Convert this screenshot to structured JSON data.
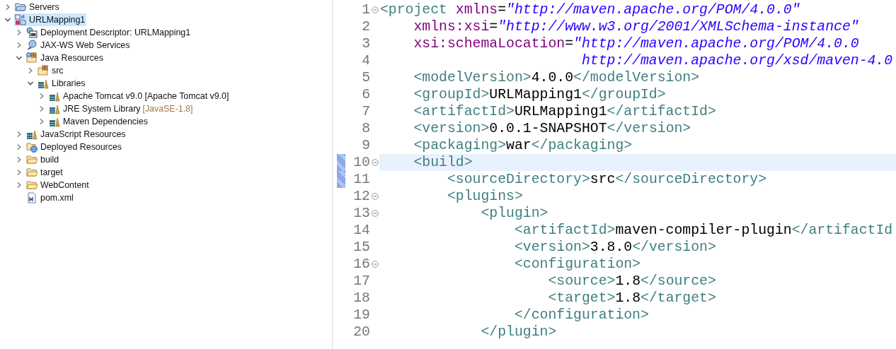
{
  "project_explorer": {
    "items": [
      {
        "label": "Servers",
        "kind": "folder-blue",
        "expanded": false,
        "selected": false
      },
      {
        "label": "URLMapping1",
        "kind": "project",
        "expanded": true,
        "selected": true,
        "children": [
          {
            "label": "Deployment Descriptor: URLMapping1",
            "kind": "descriptor",
            "expanded": false,
            "selected": false
          },
          {
            "label": "JAX-WS Web Services",
            "kind": "webservices",
            "expanded": false,
            "selected": false
          },
          {
            "label": "Java Resources",
            "kind": "java-resources",
            "expanded": true,
            "selected": false,
            "children": [
              {
                "label": "src",
                "kind": "package-folder",
                "expanded": false,
                "selected": false
              },
              {
                "label": "Libraries",
                "kind": "library",
                "expanded": true,
                "selected": false,
                "children": [
                  {
                    "label": "Apache Tomcat v9.0 [Apache Tomcat v9.0]",
                    "kind": "library",
                    "expanded": false,
                    "selected": false
                  },
                  {
                    "label": "JRE System Library",
                    "decoration": "[JavaSE-1.8]",
                    "kind": "library",
                    "expanded": false,
                    "selected": false
                  },
                  {
                    "label": "Maven Dependencies",
                    "kind": "library",
                    "expanded": false,
                    "selected": false
                  }
                ]
              }
            ]
          },
          {
            "label": "JavaScript Resources",
            "kind": "library",
            "expanded": false,
            "selected": false
          },
          {
            "label": "Deployed Resources",
            "kind": "deployed",
            "expanded": false,
            "selected": false
          },
          {
            "label": "build",
            "kind": "folder",
            "expanded": false,
            "selected": false
          },
          {
            "label": "target",
            "kind": "folder",
            "expanded": false,
            "selected": false
          },
          {
            "label": "WebContent",
            "kind": "folder",
            "expanded": false,
            "selected": false
          },
          {
            "label": "pom.xml",
            "kind": "xml-file",
            "selected": false
          }
        ]
      }
    ]
  },
  "editor": {
    "lines": [
      {
        "number": "1",
        "foldable": true,
        "current": false,
        "marked": false,
        "tokens": [
          {
            "kind": "tag",
            "text": "<project "
          },
          {
            "kind": "attr",
            "text": "xmlns"
          },
          {
            "kind": "punct",
            "text": "="
          },
          {
            "kind": "value",
            "text": "\"http://maven.apache.org/POM/4.0.0\""
          }
        ]
      },
      {
        "number": "2",
        "foldable": false,
        "current": false,
        "marked": false,
        "tokens": [
          {
            "kind": "attr",
            "text": "    xmlns:xsi"
          },
          {
            "kind": "punct",
            "text": "="
          },
          {
            "kind": "value",
            "text": "\"http://www.w3.org/2001/XMLSchema-instance\""
          }
        ]
      },
      {
        "number": "3",
        "foldable": false,
        "current": false,
        "marked": false,
        "tokens": [
          {
            "kind": "attr",
            "text": "    xsi:schemaLocation"
          },
          {
            "kind": "punct",
            "text": "="
          },
          {
            "kind": "value",
            "text": "\"http://maven.apache.org/POM/4.0.0"
          }
        ]
      },
      {
        "number": "4",
        "foldable": false,
        "current": false,
        "marked": false,
        "tokens": [
          {
            "kind": "value",
            "text": "                        http://maven.apache.org/xsd/maven-4.0"
          }
        ]
      },
      {
        "number": "5",
        "foldable": false,
        "current": false,
        "marked": false,
        "tokens": [
          {
            "kind": "tag",
            "text": "    <modelVersion>"
          },
          {
            "kind": "text",
            "text": "4.0.0"
          },
          {
            "kind": "tag",
            "text": "</modelVersion>"
          }
        ]
      },
      {
        "number": "6",
        "foldable": false,
        "current": false,
        "marked": false,
        "tokens": [
          {
            "kind": "tag",
            "text": "    <groupId>"
          },
          {
            "kind": "text",
            "text": "URLMapping1"
          },
          {
            "kind": "tag",
            "text": "</groupId>"
          }
        ]
      },
      {
        "number": "7",
        "foldable": false,
        "current": false,
        "marked": false,
        "tokens": [
          {
            "kind": "tag",
            "text": "    <artifactId>"
          },
          {
            "kind": "text",
            "text": "URLMapping1"
          },
          {
            "kind": "tag",
            "text": "</artifactId>"
          }
        ]
      },
      {
        "number": "8",
        "foldable": false,
        "current": false,
        "marked": false,
        "tokens": [
          {
            "kind": "tag",
            "text": "    <version>"
          },
          {
            "kind": "text",
            "text": "0.0.1-SNAPSHOT"
          },
          {
            "kind": "tag",
            "text": "</version>"
          }
        ]
      },
      {
        "number": "9",
        "foldable": false,
        "current": false,
        "marked": false,
        "tokens": [
          {
            "kind": "tag",
            "text": "    <packaging>"
          },
          {
            "kind": "text",
            "text": "war"
          },
          {
            "kind": "tag",
            "text": "</packaging>"
          }
        ]
      },
      {
        "number": "10",
        "foldable": true,
        "current": true,
        "marked": true,
        "tokens": [
          {
            "kind": "tag",
            "text": "    <build>"
          }
        ]
      },
      {
        "number": "11",
        "foldable": false,
        "current": false,
        "marked": true,
        "tokens": [
          {
            "kind": "tag",
            "text": "        <sourceDirectory>"
          },
          {
            "kind": "text",
            "text": "src"
          },
          {
            "kind": "tag",
            "text": "</sourceDirectory>"
          }
        ]
      },
      {
        "number": "12",
        "foldable": true,
        "current": false,
        "marked": false,
        "tokens": [
          {
            "kind": "tag",
            "text": "        <plugins>"
          }
        ]
      },
      {
        "number": "13",
        "foldable": true,
        "current": false,
        "marked": false,
        "tokens": [
          {
            "kind": "tag",
            "text": "            <plugin>"
          }
        ]
      },
      {
        "number": "14",
        "foldable": false,
        "current": false,
        "marked": false,
        "tokens": [
          {
            "kind": "tag",
            "text": "                <artifactId>"
          },
          {
            "kind": "text",
            "text": "maven-compiler-plugin"
          },
          {
            "kind": "tag",
            "text": "</artifactId"
          }
        ]
      },
      {
        "number": "15",
        "foldable": false,
        "current": false,
        "marked": false,
        "tokens": [
          {
            "kind": "tag",
            "text": "                <version>"
          },
          {
            "kind": "text",
            "text": "3.8.0"
          },
          {
            "kind": "tag",
            "text": "</version>"
          }
        ]
      },
      {
        "number": "16",
        "foldable": true,
        "current": false,
        "marked": false,
        "tokens": [
          {
            "kind": "tag",
            "text": "                <configuration>"
          }
        ]
      },
      {
        "number": "17",
        "foldable": false,
        "current": false,
        "marked": false,
        "tokens": [
          {
            "kind": "tag",
            "text": "                    <source>"
          },
          {
            "kind": "text",
            "text": "1.8"
          },
          {
            "kind": "tag",
            "text": "</source>"
          }
        ]
      },
      {
        "number": "18",
        "foldable": false,
        "current": false,
        "marked": false,
        "tokens": [
          {
            "kind": "tag",
            "text": "                    <target>"
          },
          {
            "kind": "text",
            "text": "1.8"
          },
          {
            "kind": "tag",
            "text": "</target>"
          }
        ]
      },
      {
        "number": "19",
        "foldable": false,
        "current": false,
        "marked": false,
        "tokens": [
          {
            "kind": "tag",
            "text": "                </configuration>"
          }
        ]
      },
      {
        "number": "20",
        "foldable": false,
        "current": false,
        "marked": false,
        "tokens": [
          {
            "kind": "tag",
            "text": "            </plugin>"
          }
        ]
      }
    ]
  }
}
